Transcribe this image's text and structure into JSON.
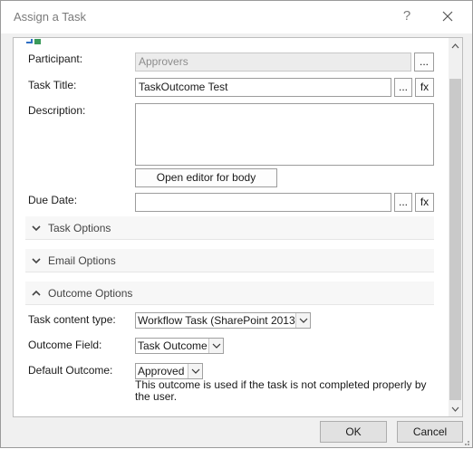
{
  "window": {
    "title": "Assign a Task",
    "help_glyph": "?"
  },
  "participant": {
    "label": "Participant:",
    "value": "Approvers",
    "browse": "..."
  },
  "task_title": {
    "label": "Task Title:",
    "value": "TaskOutcome Test",
    "browse": "...",
    "fx": "fx"
  },
  "description": {
    "label": "Description:",
    "open_editor": "Open editor for body"
  },
  "due_date": {
    "label": "Due Date:",
    "value": "",
    "browse": "...",
    "fx": "fx"
  },
  "sections": {
    "task_options": "Task Options",
    "email_options": "Email Options",
    "outcome_options": "Outcome Options"
  },
  "task_content_type": {
    "label": "Task content type:",
    "value": "Workflow Task (SharePoint 2013)"
  },
  "outcome_field": {
    "label": "Outcome Field:",
    "value": "Task Outcome"
  },
  "default_outcome": {
    "label": "Default Outcome:",
    "value": "Approved",
    "note": "This outcome is used if the task is not completed properly by the user."
  },
  "buttons": {
    "ok": "OK",
    "cancel": "Cancel"
  },
  "colors": {
    "accent_icon_blue": "#2f6fc4",
    "accent_icon_green": "#3a9a5a"
  }
}
